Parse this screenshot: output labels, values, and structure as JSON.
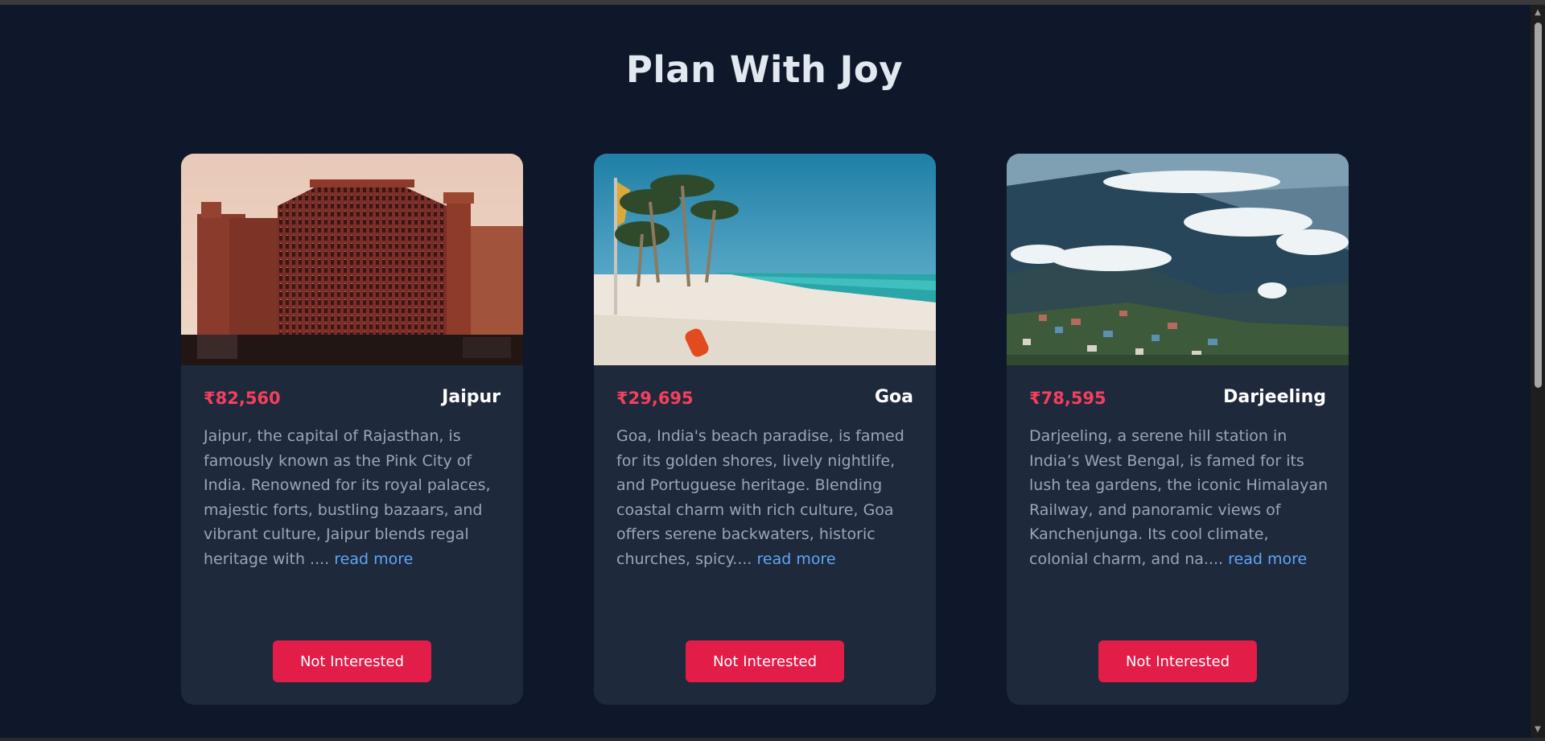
{
  "page": {
    "title": "Plan With Joy"
  },
  "cards": [
    {
      "price": "₹82,560",
      "city": "Jaipur",
      "description": "Jaipur, the capital of Rajasthan, is famously known as the Pink City of India. Renowned for its royal palaces, majestic forts, bustling bazaars, and vibrant culture, Jaipur blends regal heritage with .... ",
      "read_more": "read more",
      "button": "Not Interested",
      "image": "hawa-mahal-palace-photo"
    },
    {
      "price": "₹29,695",
      "city": "Goa",
      "description": "Goa, India's beach paradise, is famed for its golden shores, lively nightlife, and Portuguese heritage. Blending coastal charm with rich culture, Goa offers serene backwaters, historic churches, spicy.... ",
      "read_more": "read more",
      "button": "Not Interested",
      "image": "palm-beach-photo"
    },
    {
      "price": "₹78,595",
      "city": "Darjeeling",
      "description": "Darjeeling, a serene hill station in India’s West Bengal, is famed for its lush tea gardens, the iconic Himalayan Railway, and panoramic views of Kanchenjunga. Its cool climate, colonial charm, and na.... ",
      "read_more": "read more",
      "button": "Not Interested",
      "image": "hill-town-clouds-photo"
    }
  ],
  "colors": {
    "background": "#0f172a",
    "card": "#1e293b",
    "price": "#f43f5e",
    "button": "#e11d48",
    "link": "#60a5fa"
  }
}
